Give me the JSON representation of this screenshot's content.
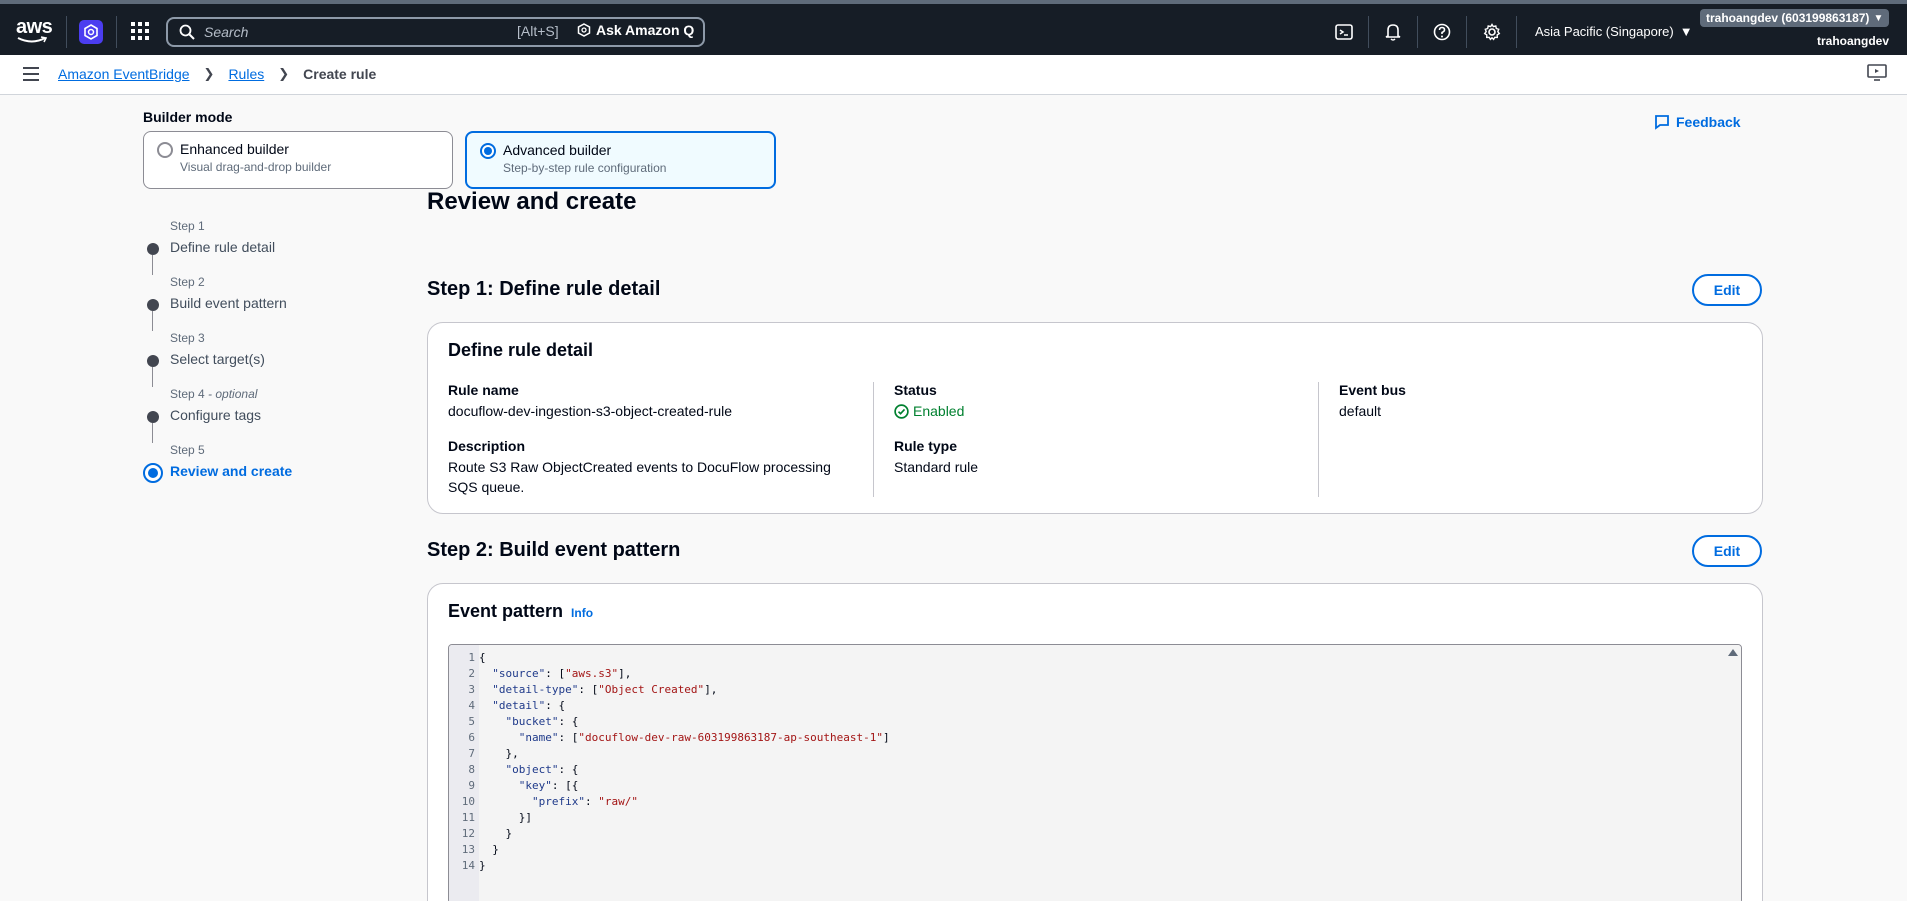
{
  "topbar": {
    "logo_text": "aws",
    "search_placeholder": "Search",
    "search_shortcut": "[Alt+S]",
    "ask_q_label": "Ask Amazon Q",
    "region": "Asia Pacific (Singapore)",
    "account": "trahoangdev (603199863187)",
    "username": "trahoangdev",
    "icons": [
      "cloudshell-icon",
      "bell-icon",
      "help-icon",
      "settings-icon"
    ]
  },
  "breadcrumb": {
    "items": [
      "Amazon EventBridge",
      "Rules"
    ],
    "current": "Create rule"
  },
  "builder": {
    "label": "Builder mode",
    "options": [
      {
        "title": "Enhanced builder",
        "subtitle": "Visual drag-and-drop builder",
        "selected": false
      },
      {
        "title": "Advanced builder",
        "subtitle": "Step-by-step rule configuration",
        "selected": true
      }
    ],
    "feedback_label": "Feedback"
  },
  "steps": [
    {
      "label": "Step 1",
      "name": "Define rule detail"
    },
    {
      "label": "Step 2",
      "name": "Build event pattern"
    },
    {
      "label": "Step 3",
      "name": "Select target(s)"
    },
    {
      "label": "Step 4",
      "optional": "- optional",
      "name": "Configure tags"
    },
    {
      "label": "Step 5",
      "name": "Review and create",
      "active": true
    }
  ],
  "page": {
    "title": "Review and create",
    "step1_heading": "Step 1: Define rule detail",
    "step2_heading": "Step 2: Build event pattern",
    "edit_label": "Edit"
  },
  "rule_detail": {
    "title": "Define rule detail",
    "rule_name_key": "Rule name",
    "rule_name": "docuflow-dev-ingestion-s3-object-created-rule",
    "description_key": "Description",
    "description": "Route S3 Raw ObjectCreated events to DocuFlow processing SQS queue.",
    "status_key": "Status",
    "status": "Enabled",
    "rule_type_key": "Rule type",
    "rule_type": "Standard rule",
    "event_bus_key": "Event bus",
    "event_bus": "default"
  },
  "event_pattern": {
    "title": "Event pattern",
    "info_label": "Info",
    "lines": [
      "{",
      "  \"source\": [\"aws.s3\"],",
      "  \"detail-type\": [\"Object Created\"],",
      "  \"detail\": {",
      "    \"bucket\": {",
      "      \"name\": [\"docuflow-dev-raw-603199863187-ap-southeast-1\"]",
      "    },",
      "    \"object\": {",
      "      \"key\": [{",
      "        \"prefix\": \"raw/\"",
      "      }]",
      "    }",
      "  }",
      "}"
    ]
  },
  "colors": {
    "topbar_bg": "#161d26",
    "link": "#006ce0",
    "status_ok": "#00802f"
  }
}
